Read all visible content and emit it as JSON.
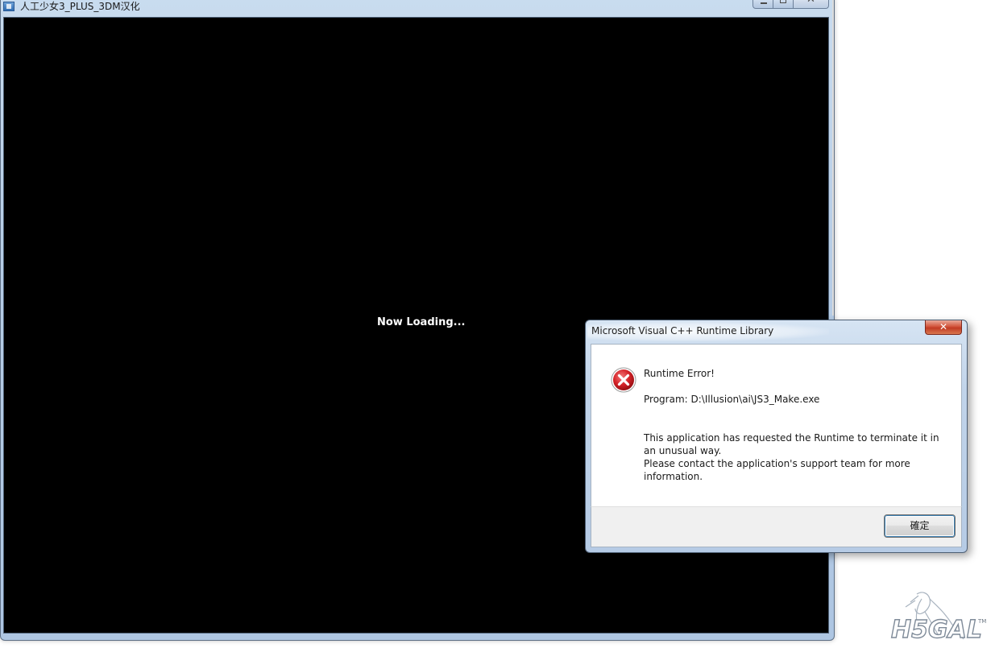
{
  "game_window": {
    "title": "人工少女3_PLUS_3DM汉化",
    "loading_text": "Now Loading...",
    "caption_close": "✕"
  },
  "dialog": {
    "title": "Microsoft Visual C++ Runtime Library",
    "close_glyph": "✕",
    "icon": "error-icon",
    "heading": "Runtime Error!",
    "program_line": "Program: D:\\Illusion\\ai\\JS3_Make.exe",
    "body_line1": "This application has requested the Runtime to terminate it in an unusual way.",
    "body_line2": "Please contact the application's support team for more information.",
    "ok_label": "確定"
  },
  "watermark": {
    "text": "H5GAL",
    "tm": "TM"
  },
  "colors": {
    "client_bg": "#000000",
    "loading_text": "#ffffff",
    "error_red": "#c4161c",
    "close_red": "#c13b24",
    "button_focus": "#3c7fb1"
  }
}
